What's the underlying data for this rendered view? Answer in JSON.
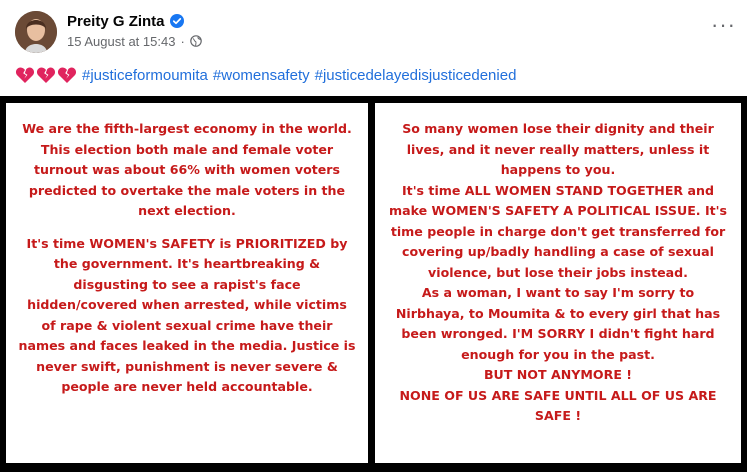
{
  "post": {
    "author": "Preity G Zinta",
    "verified_icon": "verified-badge-icon",
    "date": "15 August at 15:43",
    "separator": "·",
    "audience_icon": "globe-icon",
    "more_icon": "ellipsis-icon",
    "more_label": "···",
    "caption": {
      "emoji": [
        "broken-heart",
        "broken-heart",
        "broken-heart"
      ],
      "hashtags": [
        "#justiceformoumita",
        "#womensafety",
        "#justicedelayedisjusticedenied"
      ]
    }
  },
  "image": {
    "left_panel": {
      "paragraph_1": "We are the fifth-largest economy in the world. This election both male and female voter turnout was about 66% with women voters predicted to overtake the male voters in the next election.",
      "paragraph_2": "It's time WOMEN's SAFETY is PRIORITIZED by the government. It's heartbreaking & disgusting to see a rapist's face hidden/covered when arrested, while victims of rape & violent sexual crime have their names and faces leaked in the media. Justice is never swift, punishment is never severe & people are never held accountable."
    },
    "right_panel": {
      "paragraph_1": "So many women lose their dignity and their lives, and it never really matters, unless it happens to you.",
      "paragraph_2": "It's time ALL WOMEN STAND TOGETHER and make WOMEN'S SAFETY A POLITICAL ISSUE. It's time people in charge don't get transferred for covering up/badly handling a case of sexual violence, but lose their jobs instead.",
      "paragraph_3": "As a woman, I want to say I'm sorry to Nirbhaya, to Moumita & to every girl that has been wronged. I'M SORRY I didn't fight hard enough for you in the past.",
      "paragraph_4": "BUT NOT ANYMORE !",
      "paragraph_5": "NONE OF US ARE SAFE UNTIL ALL OF US ARE SAFE !"
    },
    "text_color": "#c61a1a",
    "background": "#000000"
  },
  "colors": {
    "hashtag": "#216fdb",
    "meta": "#65676b",
    "verified": "#1877f2",
    "heart": "#e0245e"
  }
}
